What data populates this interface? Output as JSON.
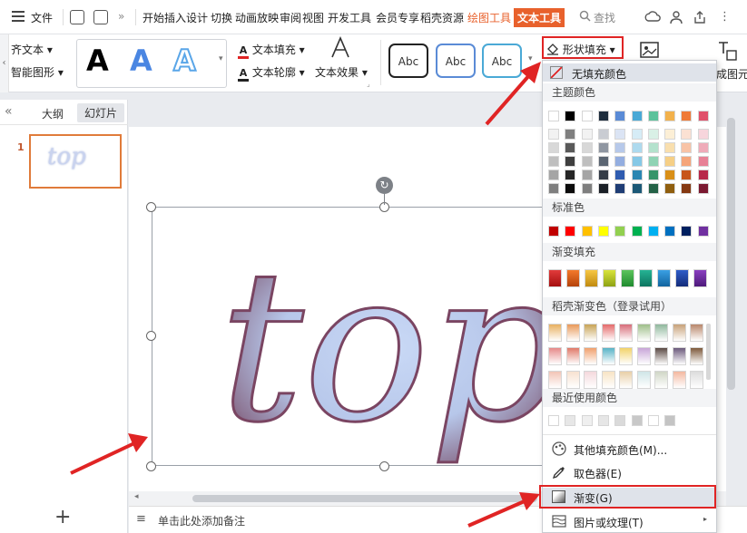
{
  "menubar": {
    "file": "文件",
    "tabs": [
      "开始",
      "插入",
      "设计",
      "切换",
      "动画",
      "放映",
      "审阅",
      "视图",
      "开发工具",
      "会员专享",
      "稻壳资源"
    ],
    "draw_tools": "绘图工具",
    "text_tools": "文本工具",
    "search": "查找"
  },
  "ribbon": {
    "align_text": "齐文本",
    "smart_shape": "智能图形",
    "text_fill": "文本填充",
    "text_outline": "文本轮廓",
    "text_effect": "文本效果",
    "style_letter": "A",
    "shape_style_label": "Abc",
    "shape_fill": "形状填充",
    "convert_picture": "成图元"
  },
  "left_panel": {
    "outline_tab": "大纲",
    "slides_tab": "幻灯片",
    "slide_number": "1",
    "thumb_text": "top"
  },
  "slide": {
    "text": "top"
  },
  "notes": {
    "placeholder": "单击此处添加备注"
  },
  "dropdown": {
    "no_fill": "无填充颜色",
    "theme_colors": "主题颜色",
    "standard_colors": "标准色",
    "gradient_fill": "渐变填充",
    "docer_gradient": "稻壳渐变色（登录试用）",
    "recent_colors": "最近使用颜色",
    "more_colors": "其他填充颜色(M)...",
    "eyedropper": "取色器(E)",
    "gradient": "渐变(G)",
    "picture_texture": "图片或纹理(T)",
    "theme_top": [
      "#ffffff",
      "#000000",
      "#ffffff",
      "#1f2d3d",
      "#5a8bd6",
      "#4aa9d6",
      "#5cc29b",
      "#f2b14c",
      "#ef7a38",
      "#e0506a"
    ],
    "theme_shades": [
      [
        "#f2f2f2",
        "#7f7f7f",
        "#f2f2f2",
        "#c9ccd2",
        "#dbe4f4",
        "#d6ecf6",
        "#d9f0e6",
        "#fcefd6",
        "#fbe1d3",
        "#f7d5dc"
      ],
      [
        "#d8d8d8",
        "#595959",
        "#d8d8d8",
        "#8f96a1",
        "#b7c9ea",
        "#aedaee",
        "#b4e2cd",
        "#f9dfae",
        "#f8c3a6",
        "#efabb9"
      ],
      [
        "#bfbfbf",
        "#3f3f3f",
        "#bfbfbf",
        "#5b6572",
        "#94aee0",
        "#86c8e6",
        "#8fd3b4",
        "#f6cf86",
        "#f5a57a",
        "#e78196"
      ],
      [
        "#a5a5a5",
        "#262626",
        "#a5a5a5",
        "#343c47",
        "#2f5cb0",
        "#2a86b2",
        "#36946a",
        "#d98f17",
        "#c7561b",
        "#b8284a"
      ],
      [
        "#7f7f7f",
        "#0c0c0c",
        "#7f7f7f",
        "#1b2027",
        "#1f3d75",
        "#1c5977",
        "#246247",
        "#905f0f",
        "#853912",
        "#7b1a31"
      ]
    ],
    "standard": [
      "#c00000",
      "#ff0000",
      "#ffc000",
      "#ffff00",
      "#92d050",
      "#00b050",
      "#00b0f0",
      "#0070c0",
      "#002060",
      "#7030a0"
    ],
    "gradients": [
      [
        "#e23b3b",
        "#a50f0f"
      ],
      [
        "#f47a2c",
        "#b4420a"
      ],
      [
        "#f7c744",
        "#c08a10"
      ],
      [
        "#d9e43c",
        "#8ea214"
      ],
      [
        "#5cc45c",
        "#1f8a2f"
      ],
      [
        "#25b394",
        "#0d7560"
      ],
      [
        "#3aa0e4",
        "#12649f"
      ],
      [
        "#2f5cc8",
        "#142c7a"
      ],
      [
        "#8a3fc0",
        "#4d1a7a"
      ]
    ],
    "docer": [
      [
        "#e8b060",
        "#e99a5a",
        "#c9a457",
        "#e56b6b",
        "#d86d7a",
        "#9fbf8a",
        "#90b89d",
        "#c8a27a",
        "#b9876b"
      ],
      [
        "#e68a8a",
        "#e07a6a",
        "#f0a06e",
        "#58b3c7",
        "#f2d36a",
        "#c9a5d8",
        "#5b4a44",
        "#6c5a7c",
        "#7e5a3c"
      ],
      [
        "#f2c4b6",
        "#f7e1d0",
        "#f4d8dc",
        "#f7e3c4",
        "#e8cfa7",
        "#cfe5e7",
        "#d0d6c6",
        "#f3b8a0",
        "#dcdcdc"
      ]
    ],
    "recent": [
      "#ffffff",
      "#e7e7e7",
      "#efefef",
      "#e6e6e6",
      "#dadada",
      "#c8c8c8",
      "#ffffff",
      "#c4c4c4"
    ]
  }
}
